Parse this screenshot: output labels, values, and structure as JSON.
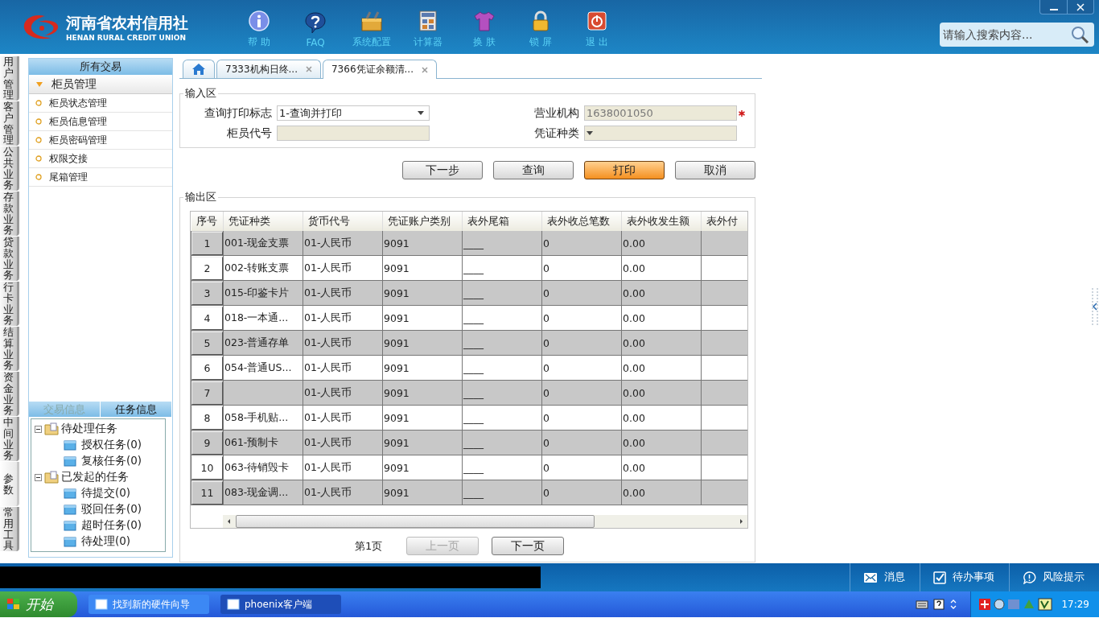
{
  "header": {
    "logo_name": "河南省农村信用社",
    "logo_subtitle": "HENAN RURAL CREDIT UNION",
    "toolbar": [
      {
        "label": "帮 助",
        "kind": "info"
      },
      {
        "label": "FAQ",
        "kind": "faq"
      },
      {
        "label": "系统配置",
        "kind": "toolbox"
      },
      {
        "label": "计算器",
        "kind": "calculator"
      },
      {
        "label": "换 肤",
        "kind": "shirt"
      },
      {
        "label": "锁 屏",
        "kind": "lock"
      },
      {
        "label": "退 出",
        "kind": "power"
      }
    ],
    "search": {
      "placeholder": "请输入搜索内容..."
    }
  },
  "side_tabs": [
    {
      "label": "用户管理",
      "selected": false
    },
    {
      "label": "客户管理",
      "selected": false
    },
    {
      "label": "公共业务",
      "selected": false
    },
    {
      "label": "存款业务",
      "selected": false
    },
    {
      "label": "贷款业务",
      "selected": false
    },
    {
      "label": "行卡业务",
      "selected": false
    },
    {
      "label": "结算业务",
      "selected": false
    },
    {
      "label": "资金业务",
      "selected": false
    },
    {
      "label": "中间业务",
      "selected": false
    },
    {
      "label": "参数",
      "selected": true
    },
    {
      "label": "常用工具",
      "selected": false
    }
  ],
  "sidebar": {
    "title": "所有交易",
    "group": {
      "label": "柜员管理",
      "expanded": true,
      "items": [
        "柜员状态管理",
        "柜员信息管理",
        "柜员密码管理",
        "权限交接",
        "尾箱管理"
      ]
    },
    "info_tabs": [
      {
        "label": "交易信息",
        "selected": false
      },
      {
        "label": "任务信息",
        "selected": true
      }
    ],
    "tree": [
      {
        "label": "待处理任务",
        "expanded": true,
        "children": [
          {
            "label": "授权任务(0)"
          },
          {
            "label": "复核任务(0)"
          }
        ]
      },
      {
        "label": "已发起的任务",
        "expanded": true,
        "children": [
          {
            "label": "待提交(0)"
          },
          {
            "label": "驳回任务(0)"
          },
          {
            "label": "超时任务(0)"
          },
          {
            "label": "待处理(0)"
          }
        ]
      }
    ]
  },
  "tabs": [
    {
      "kind": "home",
      "selected": false
    },
    {
      "kind": "page",
      "label": "7333机构日终...",
      "selected": false
    },
    {
      "kind": "page",
      "label": "7366凭证余额清...",
      "selected": true
    }
  ],
  "input_area": {
    "title": "输入区",
    "fields": [
      {
        "label": "查询打印标志",
        "kind": "select",
        "value": "1-查询并打印",
        "disabled": false
      },
      {
        "label": "营业机构",
        "kind": "text",
        "value": "1638001050",
        "disabled": true,
        "required": true
      },
      {
        "label": "柜员代号",
        "kind": "text",
        "disabled": true
      },
      {
        "label": "凭证种类",
        "kind": "select",
        "disabled": true
      }
    ]
  },
  "buttons": [
    {
      "label": "下一步",
      "highlighted": false
    },
    {
      "label": "查询",
      "highlighted": false
    },
    {
      "label": "打印",
      "highlighted": true
    },
    {
      "label": "取消",
      "highlighted": false
    }
  ],
  "output_area": {
    "title": "输出区",
    "table": {
      "columns": [
        "序号",
        "凭证种类",
        "货币代号",
        "凭证账户类别",
        "表外尾箱",
        "表外收总笔数",
        "表外收发生额",
        "表外付"
      ],
      "rows": [
        {
          "no": "1",
          "voucher_type": "001-现金支票",
          "currency": "01-人民币",
          "account_class": "9091",
          "tail_box": "____",
          "count": "0",
          "amount": "0.00"
        },
        {
          "no": "2",
          "voucher_type": "002-转账支票",
          "currency": "01-人民币",
          "account_class": "9091",
          "tail_box": "____",
          "count": "0",
          "amount": "0.00"
        },
        {
          "no": "3",
          "voucher_type": "015-印鉴卡片",
          "currency": "01-人民币",
          "account_class": "9091",
          "tail_box": "____",
          "count": "0",
          "amount": "0.00"
        },
        {
          "no": "4",
          "voucher_type": "018-一本通...",
          "currency": "01-人民币",
          "account_class": "9091",
          "tail_box": "____",
          "count": "0",
          "amount": "0.00"
        },
        {
          "no": "5",
          "voucher_type": "023-普通存单",
          "currency": "01-人民币",
          "account_class": "9091",
          "tail_box": "____",
          "count": "0",
          "amount": "0.00"
        },
        {
          "no": "6",
          "voucher_type": "054-普通US...",
          "currency": "01-人民币",
          "account_class": "9091",
          "tail_box": "____",
          "count": "0",
          "amount": "0.00"
        },
        {
          "no": "7",
          "currency": "01-人民币",
          "account_class": "9091",
          "tail_box": "____",
          "count": "0",
          "amount": "0.00"
        },
        {
          "no": "8",
          "voucher_type": "058-手机贴...",
          "currency": "01-人民币",
          "account_class": "9091",
          "tail_box": "____",
          "count": "0",
          "amount": "0.00"
        },
        {
          "no": "9",
          "voucher_type": "061-预制卡",
          "currency": "01-人民币",
          "account_class": "9091",
          "tail_box": "____",
          "count": "0",
          "amount": "0.00"
        },
        {
          "no": "10",
          "voucher_type": "063-待销毁卡",
          "currency": "01-人民币",
          "account_class": "9091",
          "tail_box": "____",
          "count": "0",
          "amount": "0.00"
        },
        {
          "no": "11",
          "voucher_type": "083-现金调...",
          "currency": "01-人民币",
          "account_class": "9091",
          "tail_box": "____",
          "count": "0",
          "amount": "0.00"
        }
      ]
    },
    "pager": {
      "page": "第1页",
      "prev": {
        "label": "上一页",
        "disabled": true
      },
      "next": {
        "label": "下一页",
        "disabled": false
      }
    }
  },
  "status_bar": {
    "items": [
      {
        "label": "消息",
        "kind": "message"
      },
      {
        "label": "待办事项",
        "kind": "todo"
      },
      {
        "label": "风险提示",
        "kind": "risk"
      }
    ]
  },
  "taskbar": {
    "start": "开始",
    "tasks": [
      {
        "label": "找到新的硬件向导",
        "selected": false
      },
      {
        "label": "phoenix客户端",
        "selected": true
      }
    ],
    "clock": "17:29"
  }
}
